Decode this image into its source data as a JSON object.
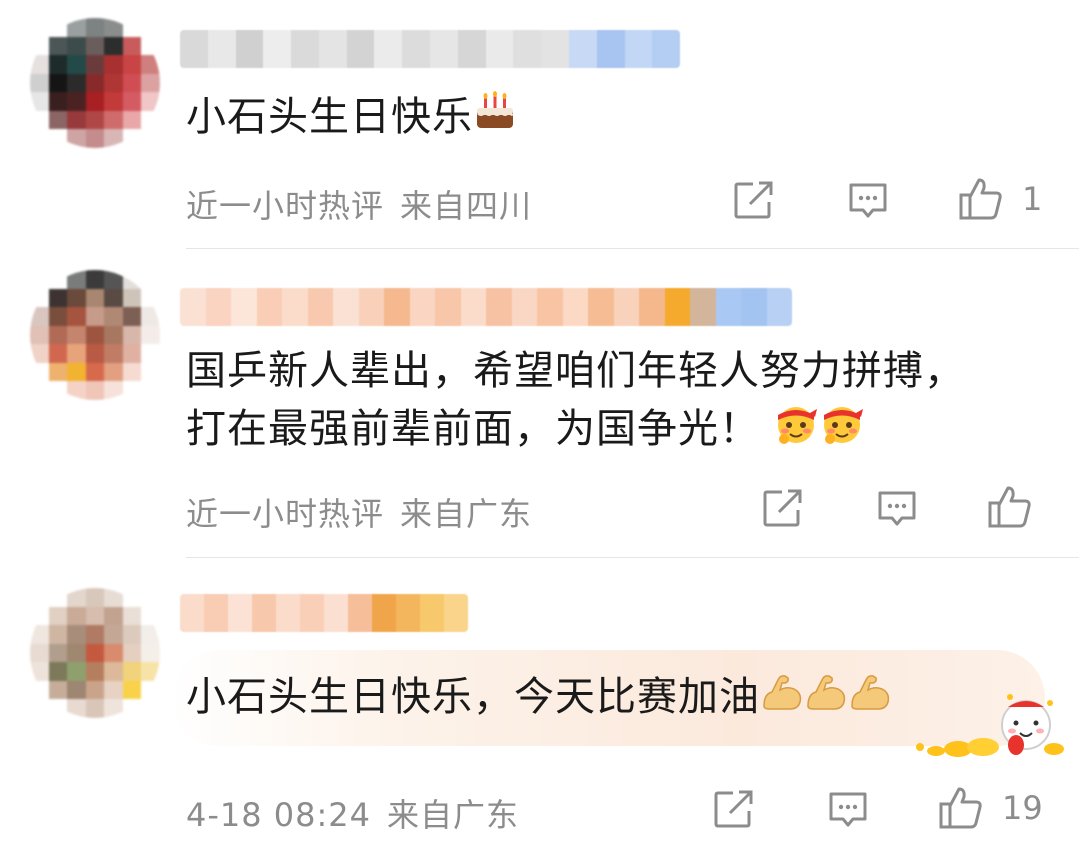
{
  "comments": [
    {
      "text": "小石头生日快乐",
      "emojis": [
        "cake-emoji"
      ],
      "time": "近一小时热评",
      "location": "来自四川",
      "likes": "1"
    },
    {
      "text_line1": "国乒新人辈出，希望咱们年轻人努力拼搏，",
      "text_line2": "打在最强前辈前面，为国争光！",
      "emojis": [
        "cheer-face-emoji",
        "cheer-face-emoji"
      ],
      "time": "近一小时热评",
      "location": "来自广东",
      "likes": ""
    },
    {
      "text": "小石头生日快乐，今天比赛加油",
      "emojis": [
        "flexed-bicep-emoji",
        "flexed-bicep-emoji",
        "flexed-bicep-emoji"
      ],
      "time": "4-18 08:24",
      "location": "来自广东",
      "likes": "19"
    }
  ],
  "icons": {
    "share": "share-icon",
    "comment": "comment-icon",
    "like": "thumbs-up-icon"
  },
  "colors": {
    "meta": "#8c8c8c",
    "text": "#1a1a1a",
    "divider": "#e6e6e6",
    "highlight_bg": "#fdf1e6"
  }
}
